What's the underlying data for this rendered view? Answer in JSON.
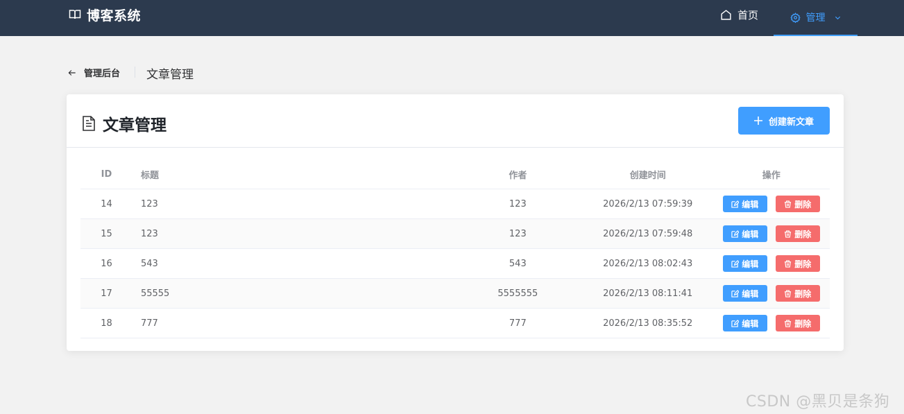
{
  "header": {
    "brand": "博客系统",
    "nav_home": "首页",
    "nav_manage": "管理"
  },
  "page": {
    "back_label": "管理后台",
    "title": "文章管理"
  },
  "card": {
    "title": "文章管理",
    "create_label": "创建新文章"
  },
  "table": {
    "columns": [
      "ID",
      "标题",
      "作者",
      "创建时间",
      "操作"
    ],
    "rows": [
      {
        "id": "14",
        "title": "123",
        "author": "123",
        "created": "2026/2/13 07:59:39"
      },
      {
        "id": "15",
        "title": "123",
        "author": "123",
        "created": "2026/2/13 07:59:48"
      },
      {
        "id": "16",
        "title": "543",
        "author": "543",
        "created": "2026/2/13 08:02:43"
      },
      {
        "id": "17",
        "title": "55555",
        "author": "5555555",
        "created": "2026/2/13 08:11:41"
      },
      {
        "id": "18",
        "title": "777",
        "author": "777",
        "created": "2026/2/13 08:35:52"
      }
    ],
    "edit_label": "编辑",
    "delete_label": "删除"
  },
  "watermark": "CSDN @黑贝是条狗",
  "colors": {
    "header_bg": "#2c3a4e",
    "primary": "#409eff",
    "danger": "#f56c6c"
  },
  "icons": [
    "book-icon",
    "home-icon",
    "gear-icon",
    "chevron-down-icon",
    "arrow-left-icon",
    "document-icon",
    "plus-icon",
    "edit-icon",
    "trash-icon"
  ]
}
